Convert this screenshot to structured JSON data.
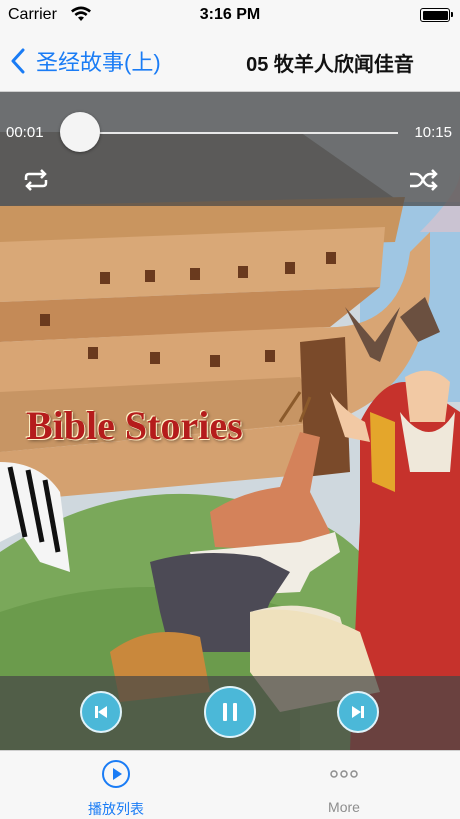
{
  "status_bar": {
    "carrier": "Carrier",
    "time": "3:16 PM"
  },
  "nav": {
    "back_label": "圣经故事(上)",
    "title": "05 牧羊人欣闻佳音"
  },
  "player": {
    "current_time": "00:01",
    "duration": "10:15",
    "progress": 0.0016,
    "artwork_caption": "Bible Stories",
    "accent_color": "#4bb8d8"
  },
  "tabbar": {
    "items": [
      {
        "label": "播放列表",
        "icon": "play-circle-icon",
        "active": true
      },
      {
        "label": "More",
        "icon": "more-dots-icon",
        "active": false
      }
    ],
    "active_color": "#1a7cf5"
  }
}
